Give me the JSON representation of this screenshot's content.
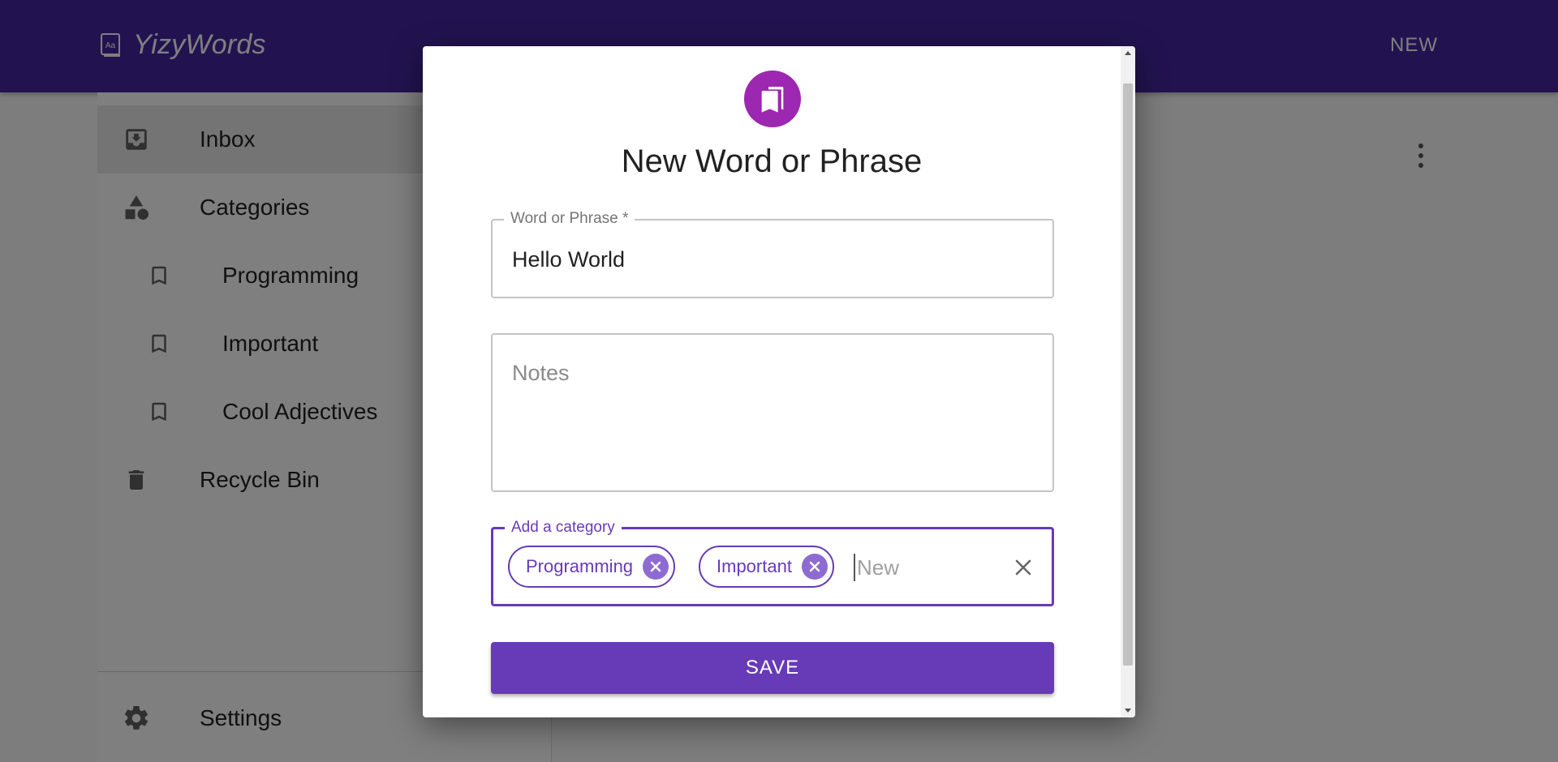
{
  "app": {
    "title": "YizyWords",
    "new_label": "NEW",
    "brand_icon": "dictionary-book-icon"
  },
  "sidebar": {
    "items": [
      {
        "label": "Inbox",
        "icon": "inbox-icon",
        "active": true
      },
      {
        "label": "Categories",
        "icon": "shapes-icon"
      },
      {
        "label": "Programming",
        "icon": "bookmark-icon"
      },
      {
        "label": "Important",
        "icon": "bookmark-icon"
      },
      {
        "label": "Cool Adjectives",
        "icon": "bookmark-icon"
      },
      {
        "label": "Recycle Bin",
        "icon": "trash-icon"
      }
    ],
    "settings_label": "Settings"
  },
  "dialog": {
    "title": "New Word or Phrase",
    "word_field": {
      "label": "Word or Phrase *",
      "value": "Hello World"
    },
    "notes_field": {
      "placeholder": "Notes",
      "value": ""
    },
    "category_field": {
      "label": "Add a category",
      "chips": [
        "Programming",
        "Important"
      ],
      "input_placeholder": "New"
    },
    "save_label": "SAVE"
  },
  "colors": {
    "appbar": "#4527a0",
    "primary": "#673ab7",
    "avatar": "#9c27b0"
  }
}
